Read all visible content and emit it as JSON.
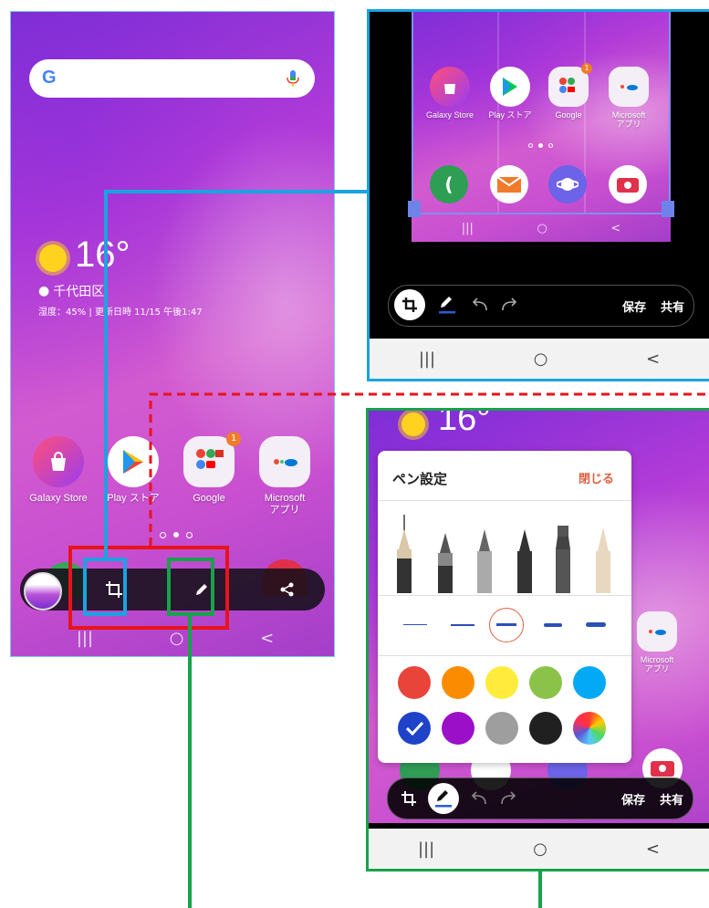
{
  "left_phone": {
    "search": {
      "g_letter": "G",
      "mic": "mic"
    },
    "weather": {
      "temp": "16°",
      "location": "千代田区",
      "details": "湿度：45% | 更新日時 11/15 午後1:47"
    },
    "apps": [
      {
        "label": "Galaxy Store"
      },
      {
        "label": "Play ストア"
      },
      {
        "label": "Google"
      },
      {
        "label": "Microsoft\nアプリ"
      }
    ],
    "google_badge": "1",
    "toolbar_icons": [
      "thumbnail",
      "crop-icon",
      "pen-icon",
      "share-icon"
    ],
    "nav": {
      "recents": "|||",
      "home": "○",
      "back": "<"
    }
  },
  "top_right_phone": {
    "apps_row1": [
      {
        "label": "Galaxy Store"
      },
      {
        "label": "Play ストア"
      },
      {
        "label": "Google"
      },
      {
        "label": "Microsoft\nアプリ"
      }
    ],
    "google_badge": "1",
    "inner_nav": {
      "recents": "|||",
      "home": "○",
      "back": "<"
    },
    "toolbar": {
      "save": "保存",
      "share": "共有"
    },
    "nav": {
      "recents": "|||",
      "home": "○",
      "back": "<"
    }
  },
  "bottom_right_phone": {
    "weather_temp": "16°",
    "pen_settings": {
      "title": "ペン設定",
      "close": "閉じる"
    },
    "side_app": {
      "label": "Microsoft\nアプリ"
    },
    "colors": [
      "#e8443a",
      "#fb8c00",
      "#ffeb3b",
      "#8bc34a",
      "#03a9f4",
      "#1f43c8",
      "#9c0fc9",
      "#9e9e9e",
      "#202020",
      "rainbow"
    ],
    "toolbar": {
      "save": "保存",
      "share": "共有"
    },
    "nav": {
      "recents": "|||",
      "home": "○",
      "back": "<"
    }
  },
  "highlight_colors": {
    "red": "#e8131b",
    "blue": "#1aa3e0",
    "green": "#16a34a"
  }
}
